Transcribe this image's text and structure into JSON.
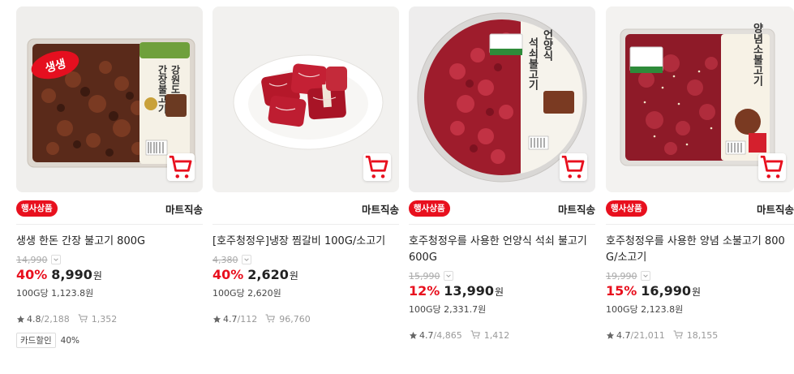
{
  "labels": {
    "event": "행사상품",
    "shipping": "마트직송",
    "won": "원",
    "card_discount": "카드할인"
  },
  "colors": {
    "accent": "#e8101e"
  },
  "products": [
    {
      "title": "생생 한돈 간장 불고기 800G",
      "has_event_badge": true,
      "original_price": "14,990",
      "discount": "40%",
      "price": "8,990",
      "unit_price": "100G당 1,123.8원",
      "rating": "4.8",
      "reviews": "2,188",
      "cart_count": "1,352",
      "card_discount": "40%",
      "package_label_1": "생생",
      "package_label_2": "강원도돼지",
      "package_label_3": "간장불고기"
    },
    {
      "title": "[호주청정우]냉장 찜갈비 100G/소고기",
      "has_event_badge": false,
      "original_price": "4,380",
      "discount": "40%",
      "price": "2,620",
      "unit_price": "100G당 2,620원",
      "rating": "4.7",
      "reviews": "112",
      "cart_count": "96,760"
    },
    {
      "title": "호주청정우를 사용한 언양식 석쇠 불고기 600G",
      "has_event_badge": true,
      "original_price": "15,990",
      "discount": "12%",
      "price": "13,990",
      "unit_price": "100G당 2,331.7원",
      "rating": "4.7",
      "reviews": "4,865",
      "cart_count": "1,412",
      "package_label_1": "언양식",
      "package_label_2": "석쇠불고기"
    },
    {
      "title": "호주청정우를 사용한 양념 소불고기 800G/소고기",
      "has_event_badge": true,
      "original_price": "19,990",
      "discount": "15%",
      "price": "16,990",
      "unit_price": "100G당 2,123.8원",
      "rating": "4.7",
      "reviews": "21,011",
      "cart_count": "18,155",
      "package_label_1": "양념소불고기"
    }
  ]
}
